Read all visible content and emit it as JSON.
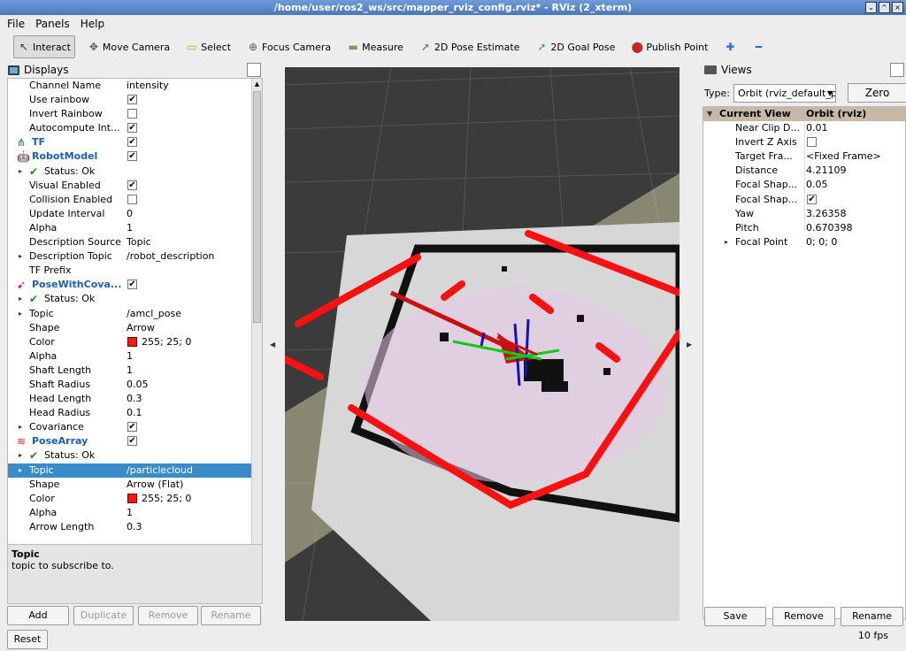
{
  "window": {
    "title": "/home/user/ros2_ws/src/mapper_rviz_config.rviz* - RViz (2_xterm)",
    "buttons": [
      "⌄",
      "^",
      "×"
    ]
  },
  "menu": [
    {
      "label": "File",
      "key": "F"
    },
    {
      "label": "Panels",
      "key": "P"
    },
    {
      "label": "Help",
      "key": "H"
    }
  ],
  "toolbar": [
    {
      "label": "Interact",
      "icon": "cursor-icon",
      "glyph": "↖",
      "color": "#333"
    },
    {
      "label": "Move Camera",
      "icon": "move-camera-icon",
      "glyph": "✥",
      "color": "#555"
    },
    {
      "label": "Select",
      "icon": "select-icon",
      "glyph": "▭",
      "color": "#c8a400"
    },
    {
      "label": "Focus Camera",
      "icon": "focus-camera-icon",
      "glyph": "⊕",
      "color": "#555"
    },
    {
      "label": "Measure",
      "icon": "ruler-icon",
      "glyph": "▬",
      "color": "#998a5a"
    },
    {
      "label": "2D Pose Estimate",
      "icon": "pose-estimate-icon",
      "glyph": "➚",
      "color": "#2a9a2a"
    },
    {
      "label": "2D Goal Pose",
      "icon": "goal-pose-icon",
      "glyph": "➚",
      "color": "#2ab02a"
    },
    {
      "label": "Publish Point",
      "icon": "map-pin-icon",
      "glyph": "⬤",
      "color": "#c62828"
    },
    {
      "label": "",
      "icon": "plus-icon",
      "glyph": "✚",
      "color": "#2a6ad8"
    },
    {
      "label": "",
      "icon": "minus-icon",
      "glyph": "━",
      "color": "#2a6ad8"
    }
  ],
  "displays": {
    "title": "Displays",
    "rows": [
      {
        "indent": 0,
        "exp": "",
        "icon": "",
        "name": "Channel Name",
        "value": "intensity",
        "check": null
      },
      {
        "indent": 0,
        "exp": "",
        "icon": "",
        "name": "Use rainbow",
        "value": "",
        "check": true
      },
      {
        "indent": 0,
        "exp": "",
        "icon": "",
        "name": "Invert Rainbow",
        "value": "",
        "check": false
      },
      {
        "indent": 0,
        "exp": "",
        "icon": "",
        "name": "Autocompute Int...",
        "value": "",
        "check": true
      },
      {
        "indent": -1,
        "exp": "",
        "icon": "tf-icon",
        "name": "TF",
        "value": "",
        "check": true,
        "plugin": true
      },
      {
        "indent": -1,
        "exp": "",
        "icon": "robot-model-icon",
        "name": "RobotModel",
        "value": "",
        "check": true,
        "plugin": true
      },
      {
        "indent": 0,
        "exp": "▸",
        "icon": "status-ok-icon",
        "name": "Status: Ok",
        "value": "",
        "check": null
      },
      {
        "indent": 0,
        "exp": "",
        "icon": "",
        "name": "Visual Enabled",
        "value": "",
        "check": true
      },
      {
        "indent": 0,
        "exp": "",
        "icon": "",
        "name": "Collision Enabled",
        "value": "",
        "check": false
      },
      {
        "indent": 0,
        "exp": "",
        "icon": "",
        "name": "Update Interval",
        "value": "0",
        "check": null
      },
      {
        "indent": 0,
        "exp": "",
        "icon": "",
        "name": "Alpha",
        "value": "1",
        "check": null
      },
      {
        "indent": 0,
        "exp": "",
        "icon": "",
        "name": "Description Source",
        "value": "Topic",
        "check": null
      },
      {
        "indent": 0,
        "exp": "▸",
        "icon": "",
        "name": "Description Topic",
        "value": "/robot_description",
        "check": null
      },
      {
        "indent": 0,
        "exp": "",
        "icon": "",
        "name": "TF Prefix",
        "value": "",
        "check": null
      },
      {
        "indent": -1,
        "exp": "",
        "icon": "pose-cov-icon",
        "name": "PoseWithCova...",
        "value": "",
        "check": true,
        "plugin": true
      },
      {
        "indent": 0,
        "exp": "▸",
        "icon": "status-ok-icon",
        "name": "Status: Ok",
        "value": "",
        "check": null
      },
      {
        "indent": 0,
        "exp": "▸",
        "icon": "",
        "name": "Topic",
        "value": "/amcl_pose",
        "check": null
      },
      {
        "indent": 0,
        "exp": "",
        "icon": "",
        "name": "Shape",
        "value": "Arrow",
        "check": null
      },
      {
        "indent": 0,
        "exp": "",
        "icon": "",
        "name": "Color",
        "value": "255; 25; 0",
        "check": null,
        "swatch": "#ff1900"
      },
      {
        "indent": 0,
        "exp": "",
        "icon": "",
        "name": "Alpha",
        "value": "1",
        "check": null
      },
      {
        "indent": 0,
        "exp": "",
        "icon": "",
        "name": "Shaft Length",
        "value": "1",
        "check": null
      },
      {
        "indent": 0,
        "exp": "",
        "icon": "",
        "name": "Shaft Radius",
        "value": "0.05",
        "check": null
      },
      {
        "indent": 0,
        "exp": "",
        "icon": "",
        "name": "Head Length",
        "value": "0.3",
        "check": null
      },
      {
        "indent": 0,
        "exp": "",
        "icon": "",
        "name": "Head Radius",
        "value": "0.1",
        "check": null
      },
      {
        "indent": 0,
        "exp": "▸",
        "icon": "",
        "name": "Covariance",
        "value": "",
        "check": true
      },
      {
        "indent": -1,
        "exp": "",
        "icon": "pose-array-icon",
        "name": "PoseArray",
        "value": "",
        "check": true,
        "plugin": true
      },
      {
        "indent": 0,
        "exp": "▸",
        "icon": "status-ok-icon",
        "name": "Status: Ok",
        "value": "",
        "check": null
      },
      {
        "indent": 0,
        "exp": "▸",
        "icon": "",
        "name": "Topic",
        "value": "/particlecloud",
        "check": null,
        "selected": true
      },
      {
        "indent": 0,
        "exp": "",
        "icon": "",
        "name": "Shape",
        "value": "Arrow (Flat)",
        "check": null
      },
      {
        "indent": 0,
        "exp": "",
        "icon": "",
        "name": "Color",
        "value": "255; 25; 0",
        "check": null,
        "swatch": "#ff1900"
      },
      {
        "indent": 0,
        "exp": "",
        "icon": "",
        "name": "Alpha",
        "value": "1",
        "check": null
      },
      {
        "indent": 0,
        "exp": "",
        "icon": "",
        "name": "Arrow Length",
        "value": "0.3",
        "check": null
      }
    ],
    "description": {
      "title": "Topic",
      "text": "topic to subscribe to."
    },
    "buttons": {
      "add": "Add",
      "duplicate": "Duplicate",
      "remove": "Remove",
      "rename": "Rename",
      "reset": "Reset"
    }
  },
  "views": {
    "title": "Views",
    "type_label": "Type:",
    "type_value": "Orbit (rviz_default_plugins)",
    "zero": "Zero",
    "header": {
      "name": "Current View",
      "value": "Orbit (rviz)"
    },
    "rows": [
      {
        "exp": "",
        "name": "Near Clip D...",
        "value": "0.01",
        "check": null
      },
      {
        "exp": "",
        "name": "Invert Z Axis",
        "value": "",
        "check": false
      },
      {
        "exp": "",
        "name": "Target Fra...",
        "value": "<Fixed Frame>",
        "check": null
      },
      {
        "exp": "",
        "name": "Distance",
        "value": "4.21109",
        "check": null
      },
      {
        "exp": "",
        "name": "Focal Shap...",
        "value": "0.05",
        "check": null
      },
      {
        "exp": "",
        "name": "Focal Shap...",
        "value": "",
        "check": true
      },
      {
        "exp": "",
        "name": "Yaw",
        "value": "3.26358",
        "check": null
      },
      {
        "exp": "",
        "name": "Pitch",
        "value": "0.670398",
        "check": null
      },
      {
        "exp": "▸",
        "name": "Focal Point",
        "value": "0; 0; 0",
        "check": null
      }
    ],
    "buttons": {
      "save": "Save",
      "remove": "Remove",
      "rename": "Rename"
    }
  },
  "status": {
    "fps": "10 fps"
  }
}
